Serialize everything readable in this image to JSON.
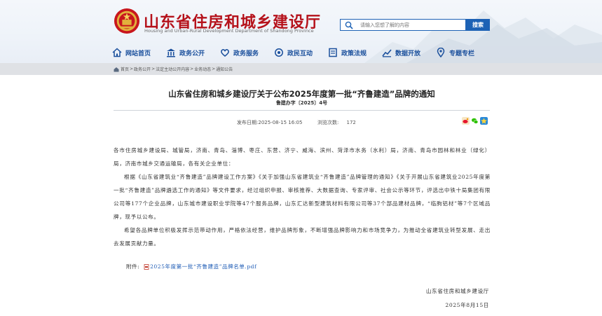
{
  "header": {
    "title": "山东省住房和城乡建设厅",
    "subtitle": "Housing and Urban-Rural Development Department of Shandong Province",
    "search_placeholder": "请输入您想了解的内容",
    "search_button": "搜索"
  },
  "nav": {
    "items": [
      {
        "label": "网站首页",
        "icon": "home-icon"
      },
      {
        "label": "政务公开",
        "icon": "building-icon"
      },
      {
        "label": "政务服务",
        "icon": "hands-icon"
      },
      {
        "label": "政民互动",
        "icon": "chat-icon"
      },
      {
        "label": "政策法规",
        "icon": "gavel-icon"
      },
      {
        "label": "数据开放",
        "icon": "chart-icon"
      },
      {
        "label": "专题专栏",
        "icon": "pin-icon"
      }
    ]
  },
  "breadcrumb": [
    "首页",
    "政务公开",
    "法定主动公开内容",
    "业务动态",
    "通知公告"
  ],
  "article": {
    "title": "山东省住房和城乡建设厅关于公布2025年度第一批“齐鲁建造”品牌的通知",
    "doc_number": "鲁建办字〔2025〕4号",
    "publish_label": "发布日期:",
    "publish_date": "2025-08-15 16:05",
    "views_label": "浏览次数:",
    "views": "172",
    "paragraphs": [
      "各市住房城乡建设局、城管局，济南、青岛、淄博、枣庄、东营、济宁、威海、滨州、菏泽市水务（水利）局，济南、青岛市园林和林业（绿化）局，济南市城乡交通运输局，各有关企业单位：",
      "根据《山东省建筑业“齐鲁建造”品牌建设工作方案》《关于加强山东省建筑业“齐鲁建造”品牌管理的通知》《关于开展山东省建筑业2025年度第一批“齐鲁建造”品牌遴选工作的通知》等文件要求，经过组织申报、审核推荐、大数据查询、专家评审、社会公示等环节，评选出中铁十局集团有限公司等177个企业品牌，山东城市建设职业学院等47个服务品牌，山东汇达新型建筑材料有限公司等37个部品建材品牌，“临朐铝材”等7个区域品牌，现予以公布。",
      "希望各品牌单位积极发挥示范带动作用，严格依法经营，维护品牌形象，不断增强品牌影响力和市场竞争力，为推动全省建筑业转型发展、走出去发展贡献力量。"
    ],
    "attachment_label": "附件:",
    "attachment_file": "2025年度第一批“齐鲁建造”品牌名单.pdf",
    "signature_org": "山东省住房和城乡建设厅",
    "signature_date": "2025年8月15日"
  },
  "colors": {
    "brand_red": "#b5121b",
    "nav_blue": "#1a4f9c",
    "button_blue": "#1d62b5"
  }
}
